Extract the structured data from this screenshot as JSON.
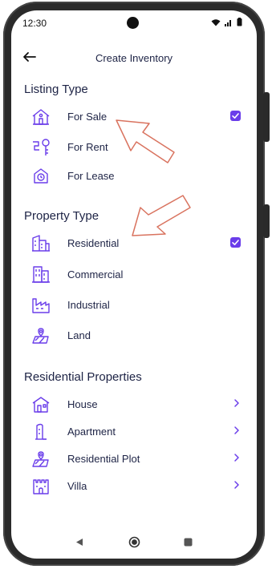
{
  "status_bar": {
    "time": "12:30"
  },
  "header": {
    "title": "Create Inventory"
  },
  "listing_type": {
    "title": "Listing Type",
    "items": [
      {
        "label": "For Sale",
        "selected": true,
        "icon": "home-sale-icon"
      },
      {
        "label": "For Rent",
        "selected": false,
        "icon": "key-icon"
      },
      {
        "label": "For Lease",
        "selected": false,
        "icon": "lease-clock-house-icon"
      }
    ]
  },
  "property_type": {
    "title": "Property Type",
    "items": [
      {
        "label": "Residential",
        "selected": true,
        "icon": "residential-building-icon"
      },
      {
        "label": "Commercial",
        "selected": false,
        "icon": "commercial-building-icon"
      },
      {
        "label": "Industrial",
        "selected": false,
        "icon": "factory-icon"
      },
      {
        "label": "Land",
        "selected": false,
        "icon": "land-pin-icon"
      }
    ]
  },
  "residential_properties": {
    "title": "Residential Properties",
    "items": [
      {
        "label": "House",
        "icon": "house-icon"
      },
      {
        "label": "Apartment",
        "icon": "apartment-icon"
      },
      {
        "label": "Residential Plot",
        "icon": "plot-pin-icon"
      },
      {
        "label": "Villa",
        "icon": "villa-castle-icon"
      }
    ]
  },
  "colors": {
    "accent": "#6a3dea",
    "text": "#1d2345",
    "annotation_arrow": "#d9735f"
  }
}
